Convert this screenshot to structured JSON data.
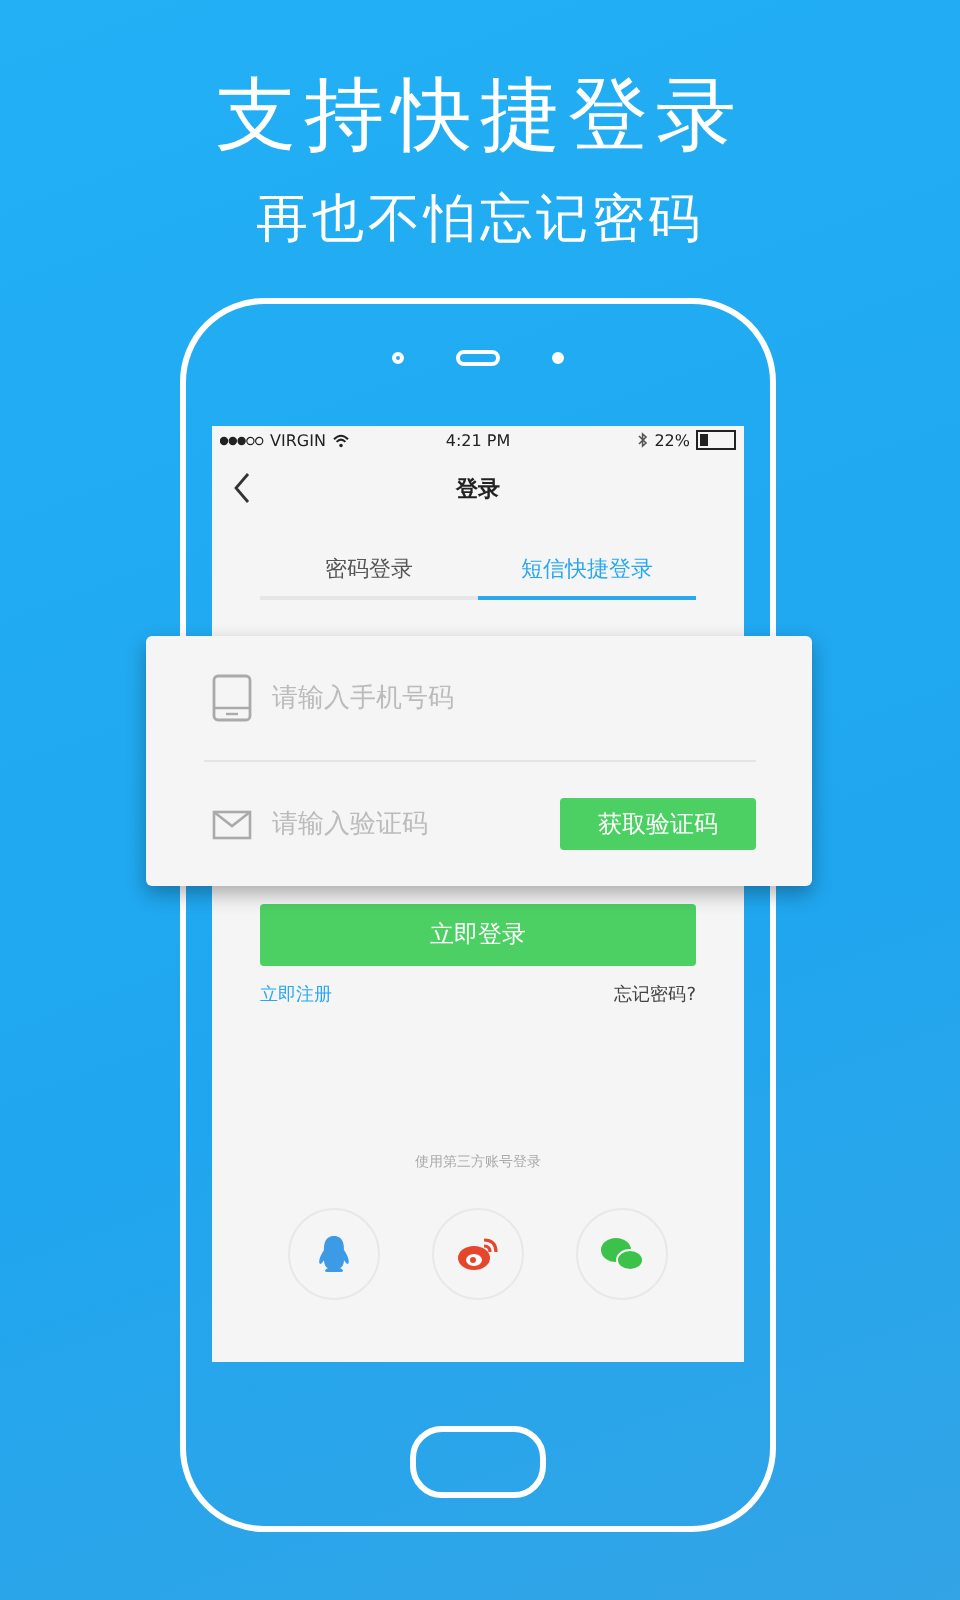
{
  "headline": "支持快捷登录",
  "subheadline": "再也不怕忘记密码",
  "status_bar": {
    "carrier": "VIRGIN",
    "time": "4:21 PM",
    "battery": "22%"
  },
  "nav": {
    "title": "登录"
  },
  "tabs": [
    {
      "label": "密码登录",
      "selected": false
    },
    {
      "label": "短信快捷登录",
      "selected": true
    }
  ],
  "form": {
    "phone_placeholder": "请输入手机号码",
    "code_placeholder": "请输入验证码",
    "get_code_button": "获取验证码",
    "login_button": "立即登录",
    "register_link": "立即注册",
    "forgot_link": "忘记密码?"
  },
  "third_party": {
    "caption": "使用第三方账号登录",
    "providers": [
      {
        "kind": "qq"
      },
      {
        "kind": "weibo"
      },
      {
        "kind": "wechat"
      }
    ]
  }
}
